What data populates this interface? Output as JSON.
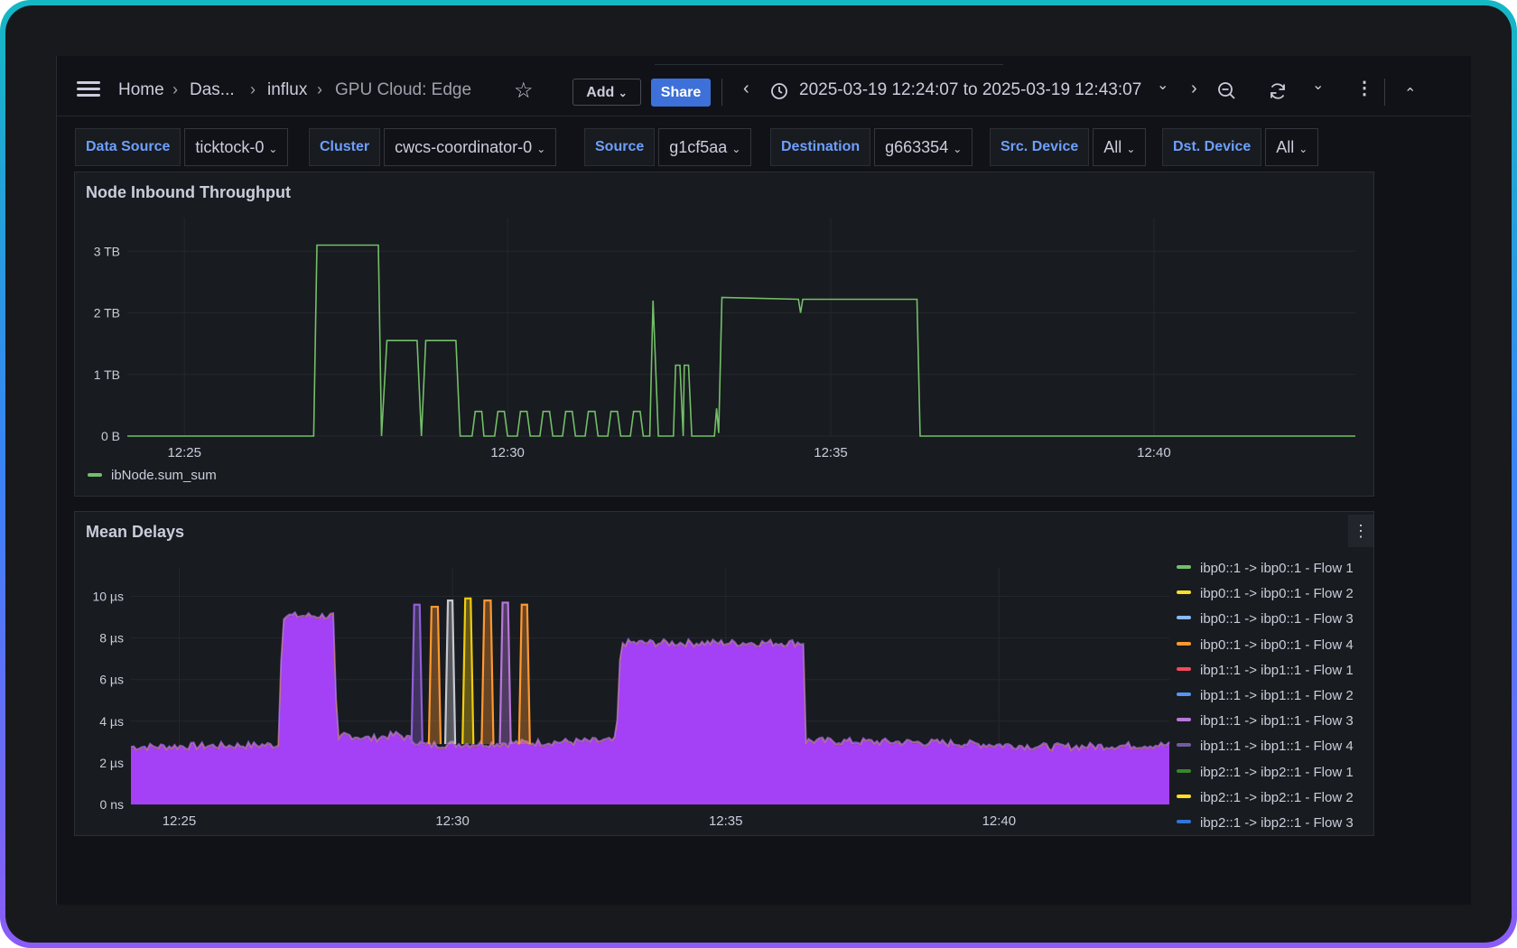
{
  "toolbar": {
    "breadcrumbs": [
      "Home",
      "Das...",
      "influx",
      "GPU Cloud: Edge"
    ],
    "add_label": "Add",
    "share_label": "Share",
    "time_range": "2025-03-19 12:24:07 to 2025-03-19 12:43:07"
  },
  "variables": [
    {
      "label": "Data Source",
      "value": "ticktock-0"
    },
    {
      "label": "Cluster",
      "value": "cwcs-coordinator-0"
    },
    {
      "label": "Source",
      "value": "g1cf5aa"
    },
    {
      "label": "Destination",
      "value": "g663354"
    },
    {
      "label": "Src. Device",
      "value": "All"
    },
    {
      "label": "Dst. Device",
      "value": "All"
    }
  ],
  "panels": {
    "throughput": {
      "title": "Node Inbound Throughput",
      "legend": "ibNode.sum_sum"
    },
    "delays": {
      "title": "Mean Delays"
    }
  },
  "chart_data": [
    {
      "type": "line",
      "title": "Node Inbound Throughput",
      "x_ticks": [
        "12:25",
        "12:30",
        "12:35",
        "12:40"
      ],
      "y_ticks": [
        "0 B",
        "1 TB",
        "2 TB",
        "3 TB"
      ],
      "ylim": [
        0,
        3.4
      ],
      "y_unit": "TB",
      "grid": true,
      "legend_position": "bottom-left",
      "color": "#73bf69",
      "series": [
        {
          "name": "ibNode.sum_sum",
          "points": [
            [
              "12:24:07",
              0
            ],
            [
              "12:27:00",
              0
            ],
            [
              "12:27:03",
              3.1
            ],
            [
              "12:28:00",
              3.1
            ],
            [
              "12:28:03",
              0
            ],
            [
              "12:28:08",
              1.55
            ],
            [
              "12:28:36",
              1.55
            ],
            [
              "12:28:40",
              0
            ],
            [
              "12:28:44",
              1.55
            ],
            [
              "12:29:12",
              1.55
            ],
            [
              "12:29:16",
              0
            ],
            [
              "12:29:27",
              0
            ],
            [
              "12:29:30",
              0.4
            ],
            [
              "12:29:36",
              0.4
            ],
            [
              "12:29:38",
              0
            ],
            [
              "12:29:48",
              0
            ],
            [
              "12:29:51",
              0.4
            ],
            [
              "12:29:57",
              0.4
            ],
            [
              "12:30:00",
              0
            ],
            [
              "12:30:09",
              0
            ],
            [
              "12:30:12",
              0.4
            ],
            [
              "12:30:18",
              0.4
            ],
            [
              "12:30:21",
              0
            ],
            [
              "12:30:30",
              0
            ],
            [
              "12:30:33",
              0.4
            ],
            [
              "12:30:39",
              0.4
            ],
            [
              "12:30:42",
              0
            ],
            [
              "12:30:51",
              0
            ],
            [
              "12:30:54",
              0.4
            ],
            [
              "12:31:00",
              0.4
            ],
            [
              "12:31:03",
              0
            ],
            [
              "12:31:12",
              0
            ],
            [
              "12:31:15",
              0.4
            ],
            [
              "12:31:21",
              0.4
            ],
            [
              "12:31:24",
              0
            ],
            [
              "12:31:33",
              0
            ],
            [
              "12:31:36",
              0.4
            ],
            [
              "12:31:42",
              0.4
            ],
            [
              "12:31:45",
              0
            ],
            [
              "12:31:54",
              0
            ],
            [
              "12:31:57",
              0.4
            ],
            [
              "12:32:03",
              0.4
            ],
            [
              "12:32:06",
              0
            ],
            [
              "12:32:12",
              0
            ],
            [
              "12:32:15",
              2.2
            ],
            [
              "12:32:20",
              0
            ],
            [
              "12:32:34",
              0
            ],
            [
              "12:32:36",
              1.15
            ],
            [
              "12:32:40",
              1.15
            ],
            [
              "12:32:43",
              0
            ],
            [
              "12:32:44",
              1.15
            ],
            [
              "12:32:48",
              1.15
            ],
            [
              "12:32:51",
              0
            ],
            [
              "12:33:12",
              0
            ],
            [
              "12:33:14",
              0.45
            ],
            [
              "12:33:16",
              0.05
            ],
            [
              "12:33:19",
              2.25
            ],
            [
              "12:34:30",
              2.22
            ],
            [
              "12:34:32",
              2.0
            ],
            [
              "12:34:34",
              2.22
            ],
            [
              "12:36:20",
              2.22
            ],
            [
              "12:36:23",
              0
            ],
            [
              "12:43:07",
              0
            ]
          ]
        }
      ]
    },
    {
      "type": "area",
      "title": "Mean Delays",
      "x_ticks": [
        "12:25",
        "12:30",
        "12:35",
        "12:40"
      ],
      "y_ticks": [
        "0 ns",
        "2 µs",
        "4 µs",
        "6 µs",
        "8 µs",
        "10 µs"
      ],
      "ylim": [
        0,
        10.5
      ],
      "y_unit": "µs",
      "stacked": false,
      "grid": true,
      "legend_position": "right",
      "base_profile": [
        [
          "12:24:07",
          2.7
        ],
        [
          "12:26:50",
          2.8
        ],
        [
          "12:26:53",
          9.0
        ],
        [
          "12:27:50",
          9.0
        ],
        [
          "12:27:53",
          2.8
        ],
        [
          "12:28:00",
          3.3
        ],
        [
          "12:28:30",
          3.1
        ],
        [
          "12:29:00",
          3.3
        ],
        [
          "12:29:30",
          2.8
        ],
        [
          "12:33:00",
          3.0
        ],
        [
          "12:33:05",
          7.7
        ],
        [
          "12:36:25",
          7.7
        ],
        [
          "12:36:28",
          3.0
        ],
        [
          "12:39:00",
          2.9
        ],
        [
          "12:41:00",
          2.7
        ],
        [
          "12:43:07",
          2.8
        ]
      ],
      "spikes": [
        {
          "start": "12:29:18",
          "end": "12:29:24",
          "value": 9.6,
          "color": "#8f5fd8"
        },
        {
          "start": "12:29:37",
          "end": "12:29:44",
          "value": 9.5,
          "color": "#ff9830"
        },
        {
          "start": "12:29:55",
          "end": "12:30:00",
          "value": 9.8,
          "color": "#c8c8d0"
        },
        {
          "start": "12:30:14",
          "end": "12:30:20",
          "value": 9.9,
          "color": "#f2cc0c"
        },
        {
          "start": "12:30:35",
          "end": "12:30:42",
          "value": 9.8,
          "color": "#ff9830"
        },
        {
          "start": "12:30:55",
          "end": "12:31:01",
          "value": 9.7,
          "color": "#b877d9"
        },
        {
          "start": "12:31:16",
          "end": "12:31:22",
          "value": 9.6,
          "color": "#ff9830"
        }
      ],
      "series": [
        {
          "name": "ibp0::1 -> ibp0::1 - Flow 1",
          "color": "#73bf69"
        },
        {
          "name": "ibp0::1 -> ibp0::1 - Flow 2",
          "color": "#fade2a"
        },
        {
          "name": "ibp0::1 -> ibp0::1 - Flow 3",
          "color": "#8ab8ff"
        },
        {
          "name": "ibp0::1 -> ibp0::1 - Flow 4",
          "color": "#ff9830"
        },
        {
          "name": "ibp1::1 -> ibp1::1 - Flow 1",
          "color": "#f2495c"
        },
        {
          "name": "ibp1::1 -> ibp1::1 - Flow 2",
          "color": "#5794f2"
        },
        {
          "name": "ibp1::1 -> ibp1::1 - Flow 3",
          "color": "#b877d9"
        },
        {
          "name": "ibp1::1 -> ibp1::1 - Flow 4",
          "color": "#705da0"
        },
        {
          "name": "ibp2::1 -> ibp2::1 - Flow 1",
          "color": "#37872d"
        },
        {
          "name": "ibp2::1 -> ibp2::1 - Flow 2",
          "color": "#fade2a"
        },
        {
          "name": "ibp2::1 -> ibp2::1 - Flow 3",
          "color": "#3274d9"
        }
      ],
      "fill_color": "#a440f5"
    }
  ]
}
